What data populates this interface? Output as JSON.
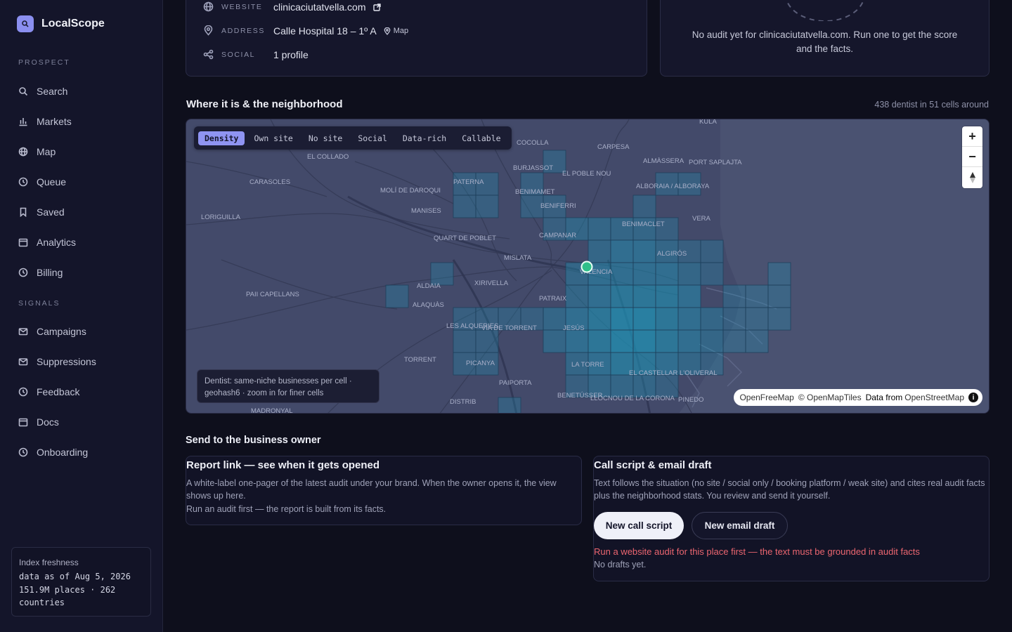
{
  "app": {
    "name": "LocalScope"
  },
  "sidebar": {
    "sections": [
      {
        "title": "PROSPECT",
        "items": [
          "Search",
          "Markets",
          "Map",
          "Queue",
          "Saved",
          "Analytics",
          "Billing"
        ]
      },
      {
        "title": "SIGNALS",
        "items": [
          "Campaigns",
          "Suppressions",
          "Feedback",
          "Docs",
          "Onboarding"
        ]
      }
    ],
    "freshness": {
      "title": "Index freshness",
      "line1": "data as of Aug 5, 2026",
      "line2": "151.9M places · 262",
      "line3": "countries"
    }
  },
  "business": {
    "website_label": "WEBSITE",
    "website": "clinicaciutatvella.com",
    "address_label": "ADDRESS",
    "address": "Calle Hospital 18 – 1º A",
    "map_link": "Map",
    "social_label": "SOCIAL",
    "social": "1 profile"
  },
  "audit": {
    "message": "No audit yet for clinicaciutatvella.com. Run one to get the score and the facts."
  },
  "neighborhood": {
    "title": "Where it is & the neighborhood",
    "count": "438 dentist in 51 cells around",
    "filters": [
      "Density",
      "Own site",
      "No site",
      "Social",
      "Data-rich",
      "Callable"
    ],
    "active_filter": "Density",
    "legend_line1": "Dentist: same-niche businesses per cell ·",
    "legend_line2": "geohash6 · zoom in for finer cells",
    "attribution": {
      "a": "OpenFreeMap",
      "b": "© OpenMapTiles",
      "c": "Data from",
      "d": "OpenStreetMap"
    },
    "places": [
      "COCOLLA",
      "BURJASSOT",
      "EL POBLE NOU",
      "ALMÀSSERA",
      "PORT SAPLAJTA",
      "CARPESA",
      "EL COLLADO",
      "CARASOLES",
      "MOLÍ DE DAROQUI",
      "PATERNA",
      "BENIMAMET",
      "ALBORAIA / ALBORAYA",
      "LORIGUILLA",
      "MANISES",
      "BENIFERRI",
      "QUART DE POBLET",
      "BENIMACLET",
      "CAMPANAR",
      "ALGIRÓS",
      "MISLATA",
      "VALENCIA",
      "PAII CAPELLANS",
      "ALDAIA",
      "XIRIVELLA",
      "ALAQUÀS",
      "PATRAIX",
      "LES ALQUERIES",
      "JESÚS",
      "VIA DE TORRENT",
      "TORRENT",
      "PICANYA",
      "LA TORRE",
      "EL CASTELLAR L'OLIVERAL",
      "PAIPORTA",
      "BENETÚSSER",
      "LLOCNOU DE LA CORONA",
      "MADRONYAL",
      "PINEDO",
      "KULA",
      "VERA",
      "DISTRIB"
    ]
  },
  "send": {
    "title": "Send to the business owner",
    "report": {
      "title": "Report link — see when it gets opened",
      "desc": "A white-label one-pager of the latest audit under your brand. When the owner opens it, the view shows up here.",
      "note": "Run an audit first — the report is built from its facts."
    },
    "script": {
      "title": "Call script & email draft",
      "desc": "Text follows the situation (no site / social only / booking platform / weak site) and cites real audit facts plus the neighborhood stats. You review and send it yourself.",
      "btn_call": "New call script",
      "btn_email": "New email draft",
      "error": "Run a website audit for this place first — the text must be grounded in audit facts",
      "empty": "No drafts yet."
    }
  }
}
